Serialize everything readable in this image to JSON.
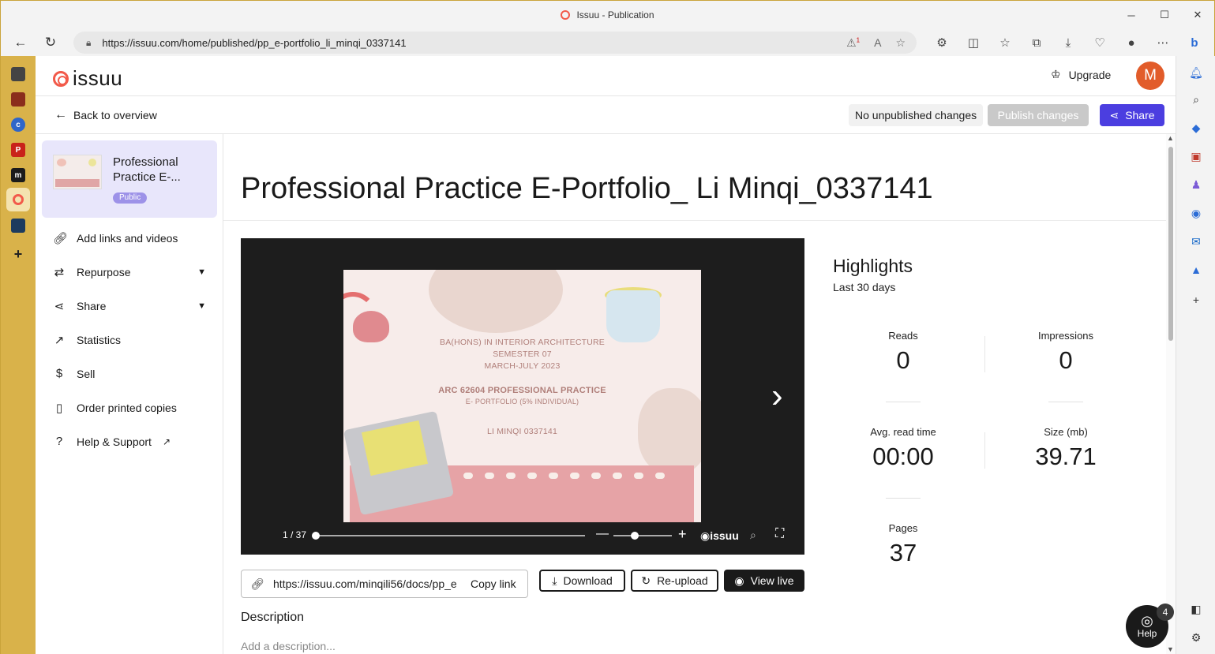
{
  "window": {
    "title": "Issuu - Publication",
    "controls": [
      "─",
      "☐",
      "✕"
    ]
  },
  "browser": {
    "url": "https://issuu.com/home/published/pp_e-portfolio_li_minqi_0337141",
    "tracking_badge": "1"
  },
  "header": {
    "logo_text": "issuu",
    "upgrade_label": "Upgrade",
    "avatar_initial": "M"
  },
  "subnav": {
    "back_label": "Back to overview",
    "status_label": "No unpublished changes",
    "publish_label": "Publish changes",
    "share_label": "Share"
  },
  "publication": {
    "card_title": "Professional Practice E-...",
    "visibility": "Public",
    "title": "Professional Practice E-Portfolio_ Li Minqi_0337141"
  },
  "sidebar": {
    "items": [
      {
        "label": "Add links and videos",
        "icon": "link-icon"
      },
      {
        "label": "Repurpose",
        "icon": "repurpose-icon"
      },
      {
        "label": "Share",
        "icon": "share-icon"
      },
      {
        "label": "Statistics",
        "icon": "trend-icon"
      },
      {
        "label": "Sell",
        "icon": "dollar-icon"
      },
      {
        "label": "Order printed copies",
        "icon": "book-icon"
      },
      {
        "label": "Help & Support",
        "icon": "question-icon"
      }
    ]
  },
  "slide": {
    "line1": "BA(HONS) IN INTERIOR ARCHITECTURE",
    "line2": "SEMESTER 07",
    "line3": "MARCH-JULY 2023",
    "line4": "ARC 62604 PROFESSIONAL PRACTICE",
    "line5": "E- PORTFOLIO (5% INDIVIDUAL)",
    "line6": "LI MINQI 0337141"
  },
  "viewer": {
    "page_indicator": "1 / 37",
    "brand": "issuu"
  },
  "actions": {
    "share_url": "https://issuu.com/minqili56/docs/pp_e",
    "copy_label": "Copy link",
    "download_label": "Download",
    "reupload_label": "Re-upload",
    "viewlive_label": "View live"
  },
  "description": {
    "heading": "Description",
    "placeholder": "Add a description..."
  },
  "highlights": {
    "title": "Highlights",
    "period": "Last 30 days",
    "reads_label": "Reads",
    "reads_value": "0",
    "impressions_label": "Impressions",
    "impressions_value": "0",
    "readtime_label": "Avg. read time",
    "readtime_value": "00:00",
    "size_label": "Size (mb)",
    "size_value": "39.71",
    "pages_label": "Pages",
    "pages_value": "37"
  },
  "help": {
    "label": "Help",
    "badge": "4"
  },
  "colors": {
    "brand_accent": "#4b3ee0",
    "logo_red": "#f25a4a",
    "avatar": "#e25c2a"
  }
}
